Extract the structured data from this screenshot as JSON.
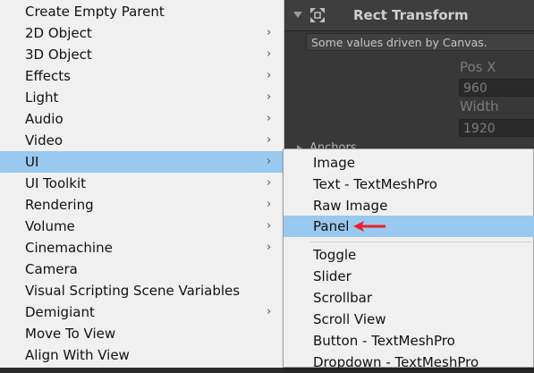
{
  "inspector": {
    "title": "Rect Transform",
    "note": "Some values driven by Canvas.",
    "pos_x_label": "Pos X",
    "pos_x_value": "960",
    "width_label": "Width",
    "width_value": "1920",
    "anchors_label": "Anchors",
    "icon": "rect-transform-icon"
  },
  "main_menu": {
    "items": [
      {
        "label": "Create Empty Parent",
        "submenu": false
      },
      {
        "label": "2D Object",
        "submenu": true
      },
      {
        "label": "3D Object",
        "submenu": true
      },
      {
        "label": "Effects",
        "submenu": true
      },
      {
        "label": "Light",
        "submenu": true
      },
      {
        "label": "Audio",
        "submenu": true
      },
      {
        "label": "Video",
        "submenu": true
      },
      {
        "label": "UI",
        "submenu": true
      },
      {
        "label": "UI Toolkit",
        "submenu": true
      },
      {
        "label": "Rendering",
        "submenu": true
      },
      {
        "label": "Volume",
        "submenu": true
      },
      {
        "label": "Cinemachine",
        "submenu": true
      },
      {
        "label": "Camera",
        "submenu": false
      },
      {
        "label": "Visual Scripting Scene Variables",
        "submenu": false
      },
      {
        "label": "Demigiant",
        "submenu": true
      },
      {
        "label": "Move To View",
        "submenu": false
      },
      {
        "label": "Align With View",
        "submenu": false
      }
    ],
    "chevron": "›"
  },
  "sub_menu": {
    "items": [
      {
        "label": "Image"
      },
      {
        "label": "Text - TextMeshPro"
      },
      {
        "label": "Raw Image"
      },
      {
        "label": "Panel"
      },
      {
        "label": "Toggle"
      },
      {
        "label": "Slider"
      },
      {
        "label": "Scrollbar"
      },
      {
        "label": "Scroll View"
      },
      {
        "label": "Button - TextMeshPro"
      },
      {
        "label": "Dropdown - TextMeshPro"
      }
    ]
  },
  "colors": {
    "highlight": "#99c9ef",
    "annotation_arrow": "#e8202a",
    "menu_bg": "#f0f0f0",
    "inspector_bg": "#383838"
  }
}
